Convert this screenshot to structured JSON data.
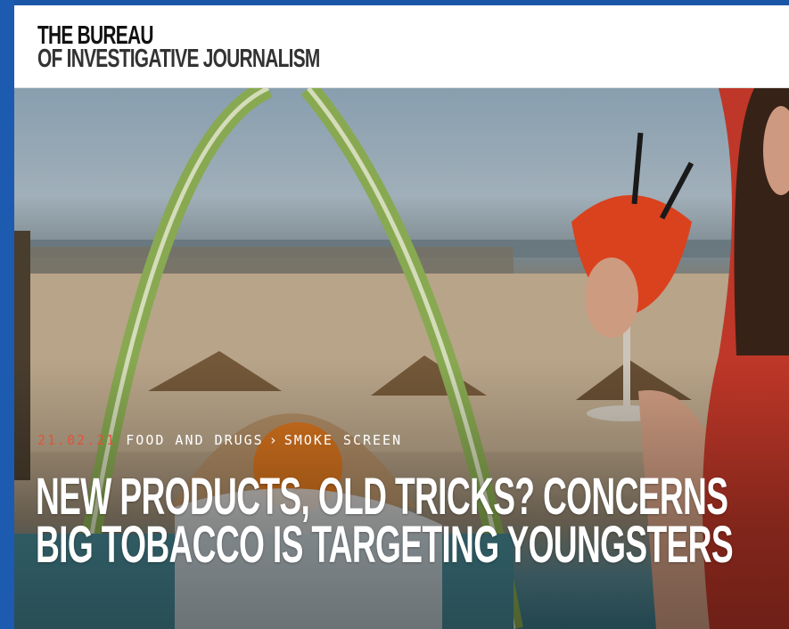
{
  "site": {
    "logo_line1": "THE BUREAU",
    "logo_line2": "OF INVESTIGATIVE JOURNALISM"
  },
  "article": {
    "date": "21.02.21",
    "category": "FOOD AND DRUGS",
    "separator": "›",
    "series": "SMOKE SCREEN",
    "headline_line1": "NEW PRODUCTS, OLD TRICKS? CONCERNS",
    "headline_line2": "BIG TOBACCO IS TARGETING YOUNGSTERS",
    "hero_image": "beach-bar-woman-cocktail-photo"
  },
  "colors": {
    "frame": "#1c5bb0",
    "date_accent": "#e0533a",
    "headline": "#ffffff"
  }
}
